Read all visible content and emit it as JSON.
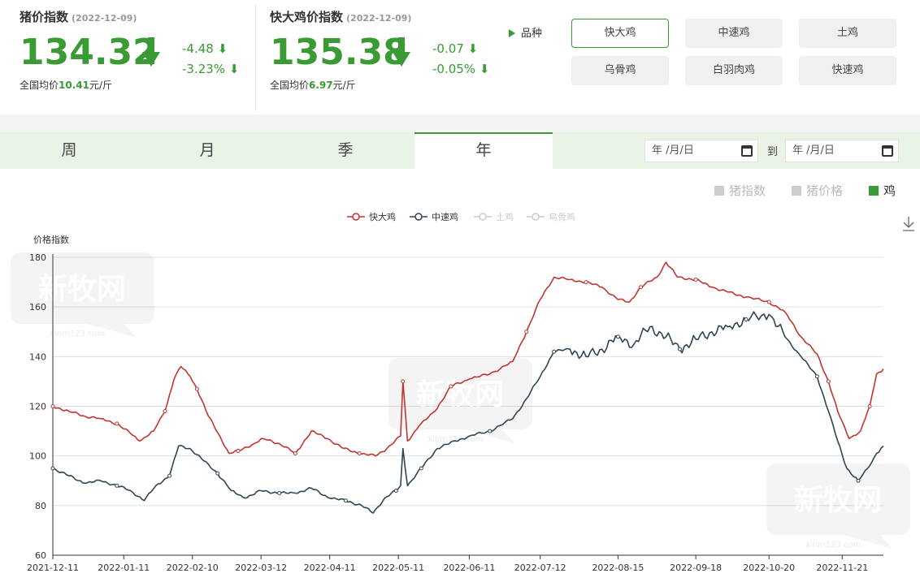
{
  "summary": {
    "pig": {
      "title": "猪价指数",
      "date": "(2022-12-09)",
      "value": "134.32",
      "change_abs": "-4.48",
      "change_pct": "-3.23%",
      "avg_prefix": "全国均价",
      "avg_value": "10.41",
      "avg_unit": "元/斤"
    },
    "chicken": {
      "title": "快大鸡价指数",
      "date": "(2022-12-09)",
      "value": "135.38",
      "change_abs": "-0.07",
      "change_pct": "-0.05%",
      "avg_prefix": "全国均价",
      "avg_value": "6.97",
      "avg_unit": "元/斤"
    }
  },
  "variety": {
    "label": "品种",
    "buttons": [
      "快大鸡",
      "中速鸡",
      "土鸡",
      "乌骨鸡",
      "白羽肉鸡",
      "快速鸡"
    ],
    "selected": "快大鸡"
  },
  "tabs": [
    "周",
    "月",
    "季",
    "年"
  ],
  "active_tab": "年",
  "date_range": {
    "start_placeholder": "年 /月/日",
    "end_placeholder": "年 /月/日",
    "separator": "到"
  },
  "toggles": [
    {
      "label": "猪指数",
      "on": false
    },
    {
      "label": "猪价格",
      "on": false
    },
    {
      "label": "鸡",
      "on": true
    }
  ],
  "icons": {
    "play": "play-triangle-icon",
    "download": "download-icon",
    "calendar": "calendar-icon",
    "arrow_down": "arrow-down-icon"
  },
  "colors": {
    "accent": "#3a9a34",
    "series_fast": "#c23531",
    "series_medium": "#2f4554",
    "series_inactive": "#cccccc"
  },
  "watermark": "新牧网",
  "watermark_url": "xinm123.com",
  "chart_data": {
    "type": "line",
    "ylabel": "价格指数",
    "ylim": [
      60,
      180
    ],
    "yticks": [
      60,
      80,
      100,
      120,
      140,
      160,
      180
    ],
    "xlim": [
      "2021-12-11",
      "2022-12-09"
    ],
    "xticks": [
      "2021-12-11",
      "2022-01-11",
      "2022-02-10",
      "2022-03-12",
      "2022-04-11",
      "2022-05-11",
      "2022-06-11",
      "2022-07-12",
      "2022-08-15",
      "2022-09-18",
      "2022-10-20",
      "2022-11-21"
    ],
    "grid": true,
    "legend_position": "top-center",
    "series": [
      {
        "name": "快大鸡",
        "active": true,
        "points": [
          [
            "2021-12-11",
            120
          ],
          [
            "2021-12-18",
            118
          ],
          [
            "2021-12-25",
            116
          ],
          [
            "2022-01-01",
            115
          ],
          [
            "2022-01-08",
            113
          ],
          [
            "2022-01-14",
            109
          ],
          [
            "2022-01-18",
            106
          ],
          [
            "2022-01-24",
            110
          ],
          [
            "2022-01-29",
            118
          ],
          [
            "2022-02-02",
            131
          ],
          [
            "2022-02-05",
            136
          ],
          [
            "2022-02-09",
            132
          ],
          [
            "2022-02-12",
            127
          ],
          [
            "2022-02-17",
            116
          ],
          [
            "2022-02-22",
            108
          ],
          [
            "2022-02-26",
            101
          ],
          [
            "2022-03-02",
            102
          ],
          [
            "2022-03-09",
            105
          ],
          [
            "2022-03-13",
            107
          ],
          [
            "2022-03-20",
            105
          ],
          [
            "2022-03-27",
            101
          ],
          [
            "2022-04-03",
            110
          ],
          [
            "2022-04-10",
            107
          ],
          [
            "2022-04-17",
            103
          ],
          [
            "2022-04-24",
            101
          ],
          [
            "2022-05-01",
            100
          ],
          [
            "2022-05-06",
            103
          ],
          [
            "2022-05-12",
            108
          ],
          [
            "2022-05-13",
            130
          ],
          [
            "2022-05-15",
            106
          ],
          [
            "2022-05-20",
            112
          ],
          [
            "2022-05-27",
            118
          ],
          [
            "2022-06-03",
            128
          ],
          [
            "2022-06-11",
            131
          ],
          [
            "2022-06-20",
            133
          ],
          [
            "2022-06-30",
            138
          ],
          [
            "2022-07-06",
            150
          ],
          [
            "2022-07-12",
            163
          ],
          [
            "2022-07-18",
            172
          ],
          [
            "2022-07-25",
            171
          ],
          [
            "2022-08-01",
            170
          ],
          [
            "2022-08-08",
            168
          ],
          [
            "2022-08-15",
            163
          ],
          [
            "2022-08-20",
            162
          ],
          [
            "2022-08-25",
            168
          ],
          [
            "2022-09-01",
            172
          ],
          [
            "2022-09-05",
            178
          ],
          [
            "2022-09-10",
            172
          ],
          [
            "2022-09-18",
            171
          ],
          [
            "2022-09-25",
            168
          ],
          [
            "2022-10-02",
            166
          ],
          [
            "2022-10-10",
            164
          ],
          [
            "2022-10-20",
            162
          ],
          [
            "2022-10-27",
            158
          ],
          [
            "2022-11-03",
            148
          ],
          [
            "2022-11-10",
            141
          ],
          [
            "2022-11-15",
            130
          ],
          [
            "2022-11-19",
            118
          ],
          [
            "2022-11-24",
            107
          ],
          [
            "2022-11-29",
            110
          ],
          [
            "2022-12-03",
            120
          ],
          [
            "2022-12-06",
            133
          ],
          [
            "2022-12-09",
            135
          ]
        ]
      },
      {
        "name": "中速鸡",
        "active": true,
        "points": [
          [
            "2021-12-11",
            95
          ],
          [
            "2021-12-18",
            92
          ],
          [
            "2021-12-25",
            89
          ],
          [
            "2022-01-01",
            90
          ],
          [
            "2022-01-08",
            88
          ],
          [
            "2022-01-14",
            86
          ],
          [
            "2022-01-20",
            82
          ],
          [
            "2022-01-25",
            88
          ],
          [
            "2022-01-31",
            92
          ],
          [
            "2022-02-04",
            104
          ],
          [
            "2022-02-09",
            103
          ],
          [
            "2022-02-15",
            98
          ],
          [
            "2022-02-21",
            93
          ],
          [
            "2022-02-27",
            86
          ],
          [
            "2022-03-05",
            83
          ],
          [
            "2022-03-12",
            86
          ],
          [
            "2022-03-20",
            85
          ],
          [
            "2022-03-27",
            85
          ],
          [
            "2022-04-03",
            87
          ],
          [
            "2022-04-11",
            83
          ],
          [
            "2022-04-18",
            82
          ],
          [
            "2022-04-25",
            80
          ],
          [
            "2022-04-30",
            77
          ],
          [
            "2022-05-05",
            83
          ],
          [
            "2022-05-10",
            86
          ],
          [
            "2022-05-12",
            88
          ],
          [
            "2022-05-13",
            103
          ],
          [
            "2022-05-15",
            88
          ],
          [
            "2022-05-21",
            95
          ],
          [
            "2022-05-28",
            103
          ],
          [
            "2022-06-05",
            106
          ],
          [
            "2022-06-11",
            108
          ],
          [
            "2022-06-20",
            110
          ],
          [
            "2022-06-30",
            115
          ],
          [
            "2022-07-06",
            123
          ],
          [
            "2022-07-12",
            132
          ],
          [
            "2022-07-18",
            142
          ],
          [
            "2022-07-25",
            143
          ],
          [
            "2022-08-01",
            140
          ],
          [
            "2022-08-08",
            143
          ],
          [
            "2022-08-15",
            148
          ],
          [
            "2022-08-22",
            145
          ],
          [
            "2022-08-29",
            152
          ],
          [
            "2022-09-05",
            148
          ],
          [
            "2022-09-11",
            143
          ],
          [
            "2022-09-18",
            147
          ],
          [
            "2022-09-25",
            150
          ],
          [
            "2022-10-02",
            152
          ],
          [
            "2022-10-10",
            155
          ],
          [
            "2022-10-20",
            157
          ],
          [
            "2022-10-27",
            148
          ],
          [
            "2022-11-03",
            140
          ],
          [
            "2022-11-10",
            132
          ],
          [
            "2022-11-15",
            118
          ],
          [
            "2022-11-19",
            106
          ],
          [
            "2022-11-23",
            95
          ],
          [
            "2022-11-28",
            90
          ],
          [
            "2022-12-03",
            96
          ],
          [
            "2022-12-06",
            101
          ],
          [
            "2022-12-09",
            104
          ]
        ]
      },
      {
        "name": "土鸡",
        "active": false,
        "points": []
      },
      {
        "name": "乌骨鸡",
        "active": false,
        "points": []
      }
    ]
  }
}
